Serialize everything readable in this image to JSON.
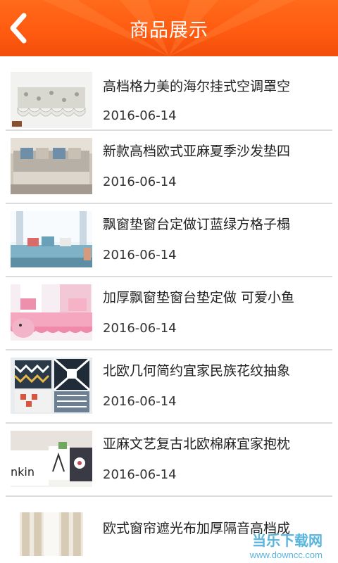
{
  "header": {
    "title": "商品展示",
    "back_icon": "chevron-left-icon",
    "bg_color": "#ff5a10"
  },
  "items": [
    {
      "title": "高档格力美的海尔挂式空调罩空",
      "date": "2016-06-14"
    },
    {
      "title": "新款高档欧式亚麻夏季沙发垫四",
      "date": "2016-06-14"
    },
    {
      "title": "飘窗垫窗台定做订蓝绿方格子榻",
      "date": "2016-06-14"
    },
    {
      "title": "加厚飘窗垫窗台垫定做 可爱小鱼",
      "date": "2016-06-14"
    },
    {
      "title": "北欧几何简约宜家民族花纹抽象",
      "date": "2016-06-14"
    },
    {
      "title": "亚麻文艺复古北欧棉麻宜家抱枕",
      "date": "2016-06-14"
    },
    {
      "title": "欧式窗帘遮光布加厚隔音高档成",
      "date": ""
    }
  ],
  "watermark": {
    "line1": "当乐下载网",
    "line2": "www.downcc.com"
  }
}
